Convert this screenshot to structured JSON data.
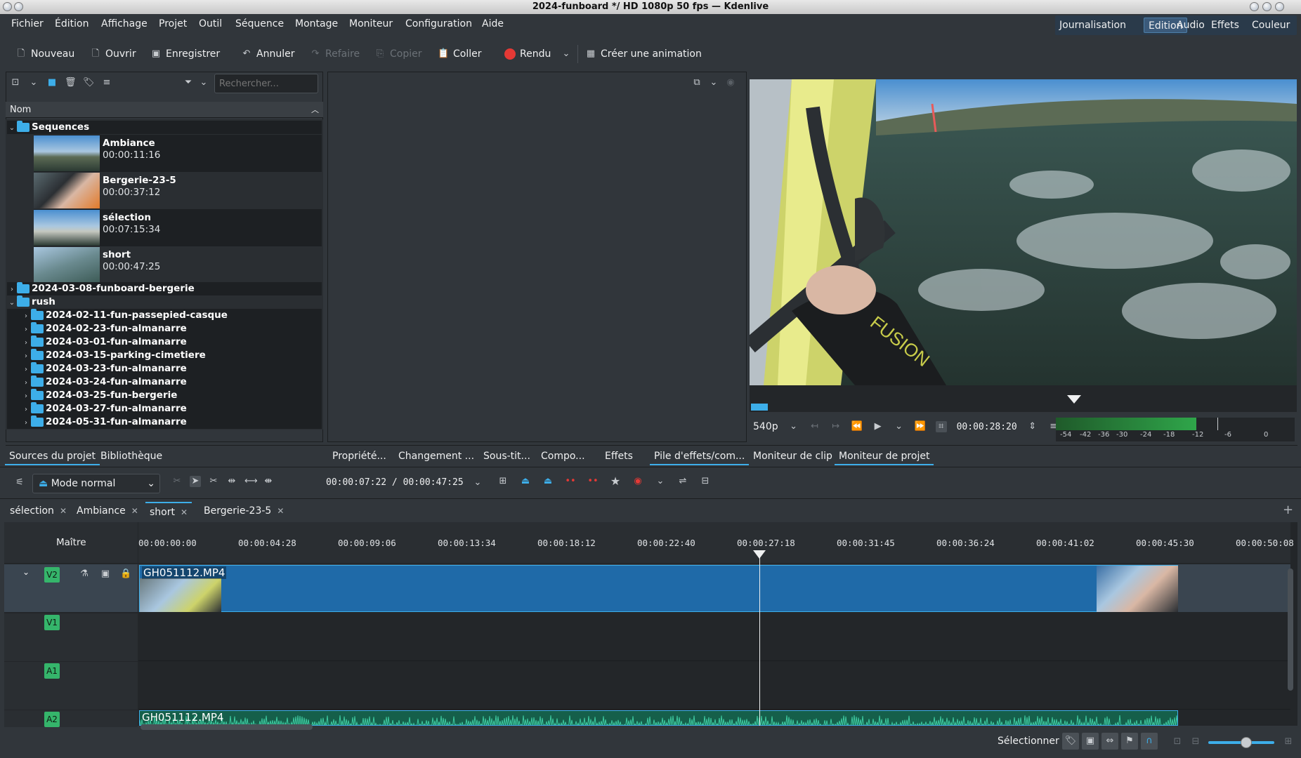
{
  "window": {
    "title": "2024-funboard */ HD 1080p 50 fps — Kdenlive"
  },
  "menu": [
    "Fichier",
    "Édition",
    "Affichage",
    "Projet",
    "Outil",
    "Séquence",
    "Montage",
    "Moniteur",
    "Configuration",
    "Aide"
  ],
  "workspaces": [
    "Journalisation",
    "Edition",
    "Audio",
    "Effets",
    "Couleur"
  ],
  "active_workspace": "Edition",
  "toolbar": {
    "new": "Nouveau",
    "open": "Ouvrir",
    "save": "Enregistrer",
    "undo": "Annuler",
    "redo": "Refaire",
    "copy": "Copier",
    "paste": "Coller",
    "render": "Rendu",
    "animation": "Créer une animation"
  },
  "bin": {
    "search_placeholder": "Rechercher...",
    "column_header": "Nom",
    "sequences_folder": "Sequences",
    "sequences": [
      {
        "name": "Ambiance",
        "duration": "00:00:11:16"
      },
      {
        "name": "Bergerie-23-5",
        "duration": "00:00:37:12"
      },
      {
        "name": "sélection",
        "duration": "00:07:15:34"
      },
      {
        "name": "short",
        "duration": "00:00:47:25"
      }
    ],
    "folder_2": "2024-03-08-funboard-bergerie",
    "rush_folder": "rush",
    "rush_subfolders": [
      "2024-02-11-fun-passepied-casque",
      "2024-02-23-fun-almanarre",
      "2024-03-01-fun-almanarre",
      "2024-03-15-parking-cimetiere",
      "2024-03-23-fun-almanarre",
      "2024-03-24-fun-almanarre",
      "2024-03-25-fun-bergerie",
      "2024-03-27-fun-almanarre",
      "2024-05-31-fun-almanarre"
    ]
  },
  "dock_tabs": {
    "left": [
      "Sources du projet",
      "Bibliothèque"
    ],
    "middle": [
      "Propriété...",
      "Changement ...",
      "Sous-tit...",
      "Compo...",
      "Effets",
      "Pile d'effets/com..."
    ],
    "right": [
      "Moniteur de clip",
      "Moniteur de projet"
    ]
  },
  "monitor": {
    "resolution": "540p",
    "timecode": "00:00:28:20",
    "meter_scale": [
      "-54",
      "-42",
      "-36",
      "-30",
      "-24",
      "-18",
      "-12",
      "-6",
      "0"
    ],
    "logo_text": "FUSION"
  },
  "timeline_toolbar": {
    "mode": "Mode normal",
    "position": "00:00:07:22 / 00:00:47:25"
  },
  "timeline_tabs": [
    "sélection",
    "Ambiance",
    "short",
    "Bergerie-23-5"
  ],
  "active_timeline_tab": "short",
  "timeline": {
    "master_label": "Maître",
    "ruler": [
      "00:00:00:00",
      "00:00:04:28",
      "00:00:09:06",
      "00:00:13:34",
      "00:00:18:12",
      "00:00:22:40",
      "00:00:27:18",
      "00:00:31:45",
      "00:00:36:24",
      "00:00:41:02",
      "00:00:45:30",
      "00:00:50:08"
    ],
    "tracks": [
      "V2",
      "V1",
      "A1",
      "A2"
    ],
    "clip_name": "GH051112.MP4"
  },
  "status": {
    "select_label": "Sélectionner"
  },
  "colors": {
    "accent": "#3daee9",
    "clip_blue": "#1f6aa8",
    "track_green": "#35b56b",
    "render_red": "#e53935"
  }
}
